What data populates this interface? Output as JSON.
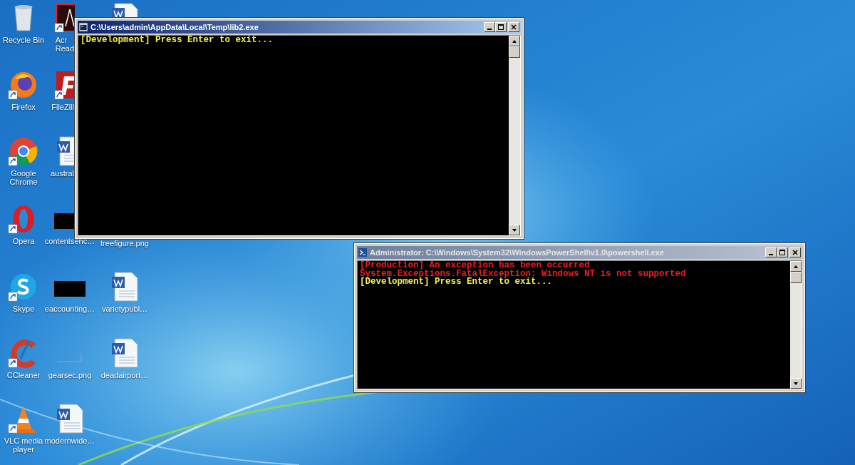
{
  "desktop_icons": [
    {
      "label": "Recycle Bin",
      "kind": "recycle-bin"
    },
    {
      "label": "Firefox",
      "kind": "firefox"
    },
    {
      "label": "Google\nChrome",
      "kind": "chrome"
    },
    {
      "label": "Opera",
      "kind": "opera"
    },
    {
      "label": "Skype",
      "kind": "skype"
    },
    {
      "label": "CCleaner",
      "kind": "ccleaner"
    },
    {
      "label": "VLC media\nplayer",
      "kind": "vlc"
    },
    {
      "label": "Acr\nRead",
      "kind": "acrobat"
    },
    {
      "label": "FileZill",
      "kind": "filezilla"
    },
    {
      "label": "austral",
      "kind": "word"
    },
    {
      "label": "contentsenc…",
      "kind": "dark-image"
    },
    {
      "label": "eaccounting…",
      "kind": "dark-image"
    },
    {
      "label": "gearsec.png",
      "kind": "blank-image"
    },
    {
      "label": "modernwide…",
      "kind": "word"
    },
    {
      "kind": "word"
    },
    {
      "label": "treefigure.png",
      "kind": "covered"
    },
    {
      "label": "varietypubl…",
      "kind": "word"
    },
    {
      "label": "deadairport…",
      "kind": "word"
    }
  ],
  "windows": [
    {
      "title": "C:\\Users\\admin\\AppData\\Local\\Temp\\lib2.exe",
      "kind": "cmd",
      "active": true,
      "lines": [
        {
          "text": "[Development] Press Enter to exit...",
          "kind": "info"
        }
      ]
    },
    {
      "title": "Administrator: C:\\Windows\\System32\\WindowsPowerShell\\v1.0\\powershell.exe",
      "kind": "powershell",
      "active": false,
      "lines": [
        {
          "text": "[Production] An exception has been occurred",
          "kind": "error"
        },
        {
          "text": "System.Exceptions.FatalException: Windows NT is not supported",
          "kind": "error"
        },
        {
          "text": "[Development] Press Enter to exit...",
          "kind": "info"
        }
      ]
    }
  ]
}
